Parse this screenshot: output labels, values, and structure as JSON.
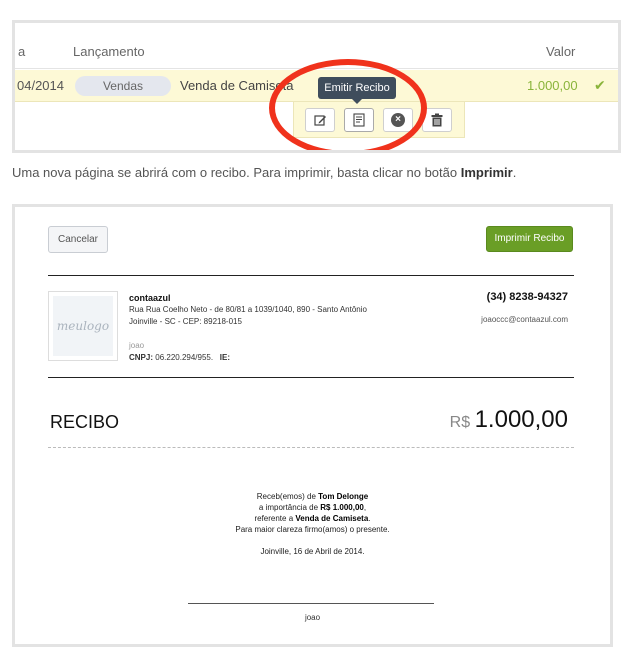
{
  "list_view": {
    "columns": {
      "date_partial": "a",
      "launch": "Lançamento",
      "value": "Valor"
    },
    "row": {
      "date": "04/2014",
      "category": "Vendas",
      "description": "Venda de Camiseta",
      "value": "1.000,00",
      "status_icon": "check-icon"
    },
    "actions": [
      {
        "name": "edit-icon"
      },
      {
        "name": "receipt-icon"
      },
      {
        "name": "cancel-icon"
      },
      {
        "name": "trash-icon"
      }
    ],
    "tooltip": "Emitir Recibo",
    "highlight_color": "#f0321c"
  },
  "instruction": {
    "text": "Uma nova página se abrirá com o recibo. Para imprimir, basta clicar no botão ",
    "bold": "Imprimir",
    "end": "."
  },
  "receipt": {
    "cancel_label": "Cancelar",
    "print_label": "Imprimir Recibo",
    "accent": "#6a9e26",
    "logo_text": "meulogo",
    "company": {
      "name": "contaazul",
      "address": "Rua Rua Coelho Neto - de 80/81 a 1039/1040, 890 - Santo Antônio",
      "city": "Joinville - SC - CEP: 89218-015",
      "user": "joao",
      "cnpj_label": "CNPJ:",
      "cnpj": "06.220.294/955.",
      "ie_label": "IE:"
    },
    "phone": "(34) 8238-94327",
    "email": "joaoccc@contaazul.com",
    "title": "RECIBO",
    "currency": "R$",
    "amount": "1.000,00",
    "body": {
      "l1_pre": "Receb(emos) de ",
      "payer": "Tom Delonge",
      "l2_pre": "a importância de ",
      "amount_text": "R$ 1.000,00",
      "l2_post": ",",
      "l3_pre": "referente a ",
      "reference": "Venda de Camiseta",
      "l3_post": ".",
      "l4": "Para maior clareza firmo(amos) o presente."
    },
    "date_line": "Joinville, 16 de Abril de 2014.",
    "signature_name": "joao"
  }
}
